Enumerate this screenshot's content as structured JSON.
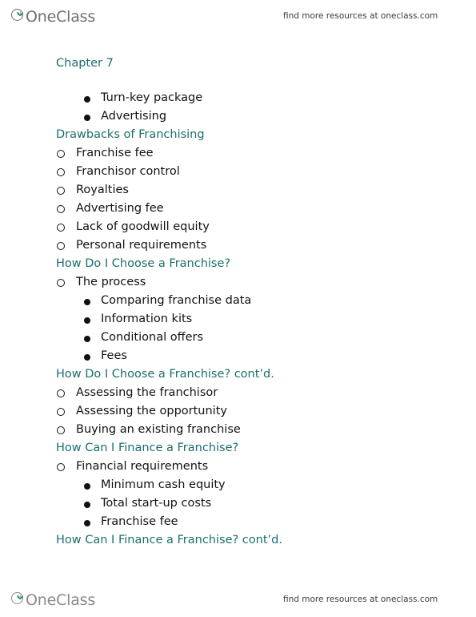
{
  "header": {
    "logo_text": "OneClass",
    "logo_icon": "sprout-circle-icon",
    "promo_text": "find more resources at oneclass.com"
  },
  "footer": {
    "logo_text": "OneClass",
    "logo_icon": "sprout-circle-icon",
    "promo_text": "find more resources at oneclass.com"
  },
  "colors": {
    "heading_teal": "#1b6e6b",
    "body_text": "#111111",
    "logo_gray": "#6f6f6f",
    "logo_sprout_green": "#2e8b57"
  },
  "document": {
    "chapter_title": "Chapter 7",
    "blocks": [
      {
        "type": "list2",
        "items": [
          "Turn-key package",
          "Advertising"
        ]
      },
      {
        "type": "heading",
        "text": "Drawbacks of Franchising"
      },
      {
        "type": "list1",
        "items": [
          "Franchise fee",
          "Franchisor control",
          "Royalties",
          "Advertising fee",
          "Lack of goodwill equity",
          "Personal requirements"
        ]
      },
      {
        "type": "heading",
        "text": "How Do I Choose a Franchise?"
      },
      {
        "type": "list1",
        "items": [
          "The process"
        ]
      },
      {
        "type": "list2",
        "items": [
          "Comparing franchise data",
          "Information kits",
          "Conditional offers",
          "Fees"
        ]
      },
      {
        "type": "heading",
        "text": "How Do I Choose a Franchise? cont’d."
      },
      {
        "type": "list1",
        "items": [
          "Assessing the franchisor",
          "Assessing the opportunity",
          "Buying an existing franchise"
        ]
      },
      {
        "type": "heading",
        "text": "How Can I Finance a Franchise?"
      },
      {
        "type": "list1",
        "items": [
          "Financial requirements"
        ]
      },
      {
        "type": "list2",
        "items": [
          "Minimum cash equity",
          "Total start-up costs",
          "Franchise fee"
        ]
      },
      {
        "type": "heading",
        "text": "How Can I Finance a Franchise? cont’d."
      }
    ]
  }
}
